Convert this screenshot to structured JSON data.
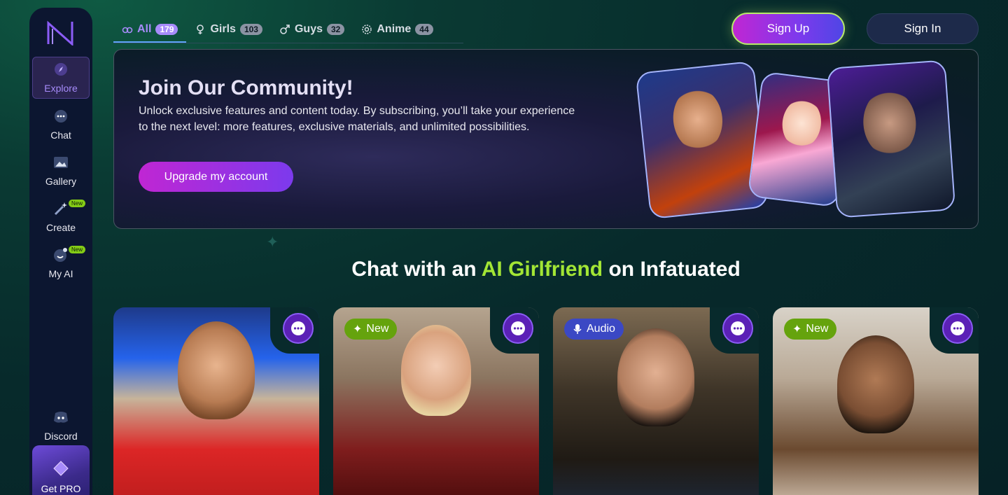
{
  "sidebar": {
    "items": [
      {
        "label": "Explore",
        "icon": "compass-icon",
        "new": false
      },
      {
        "label": "Chat",
        "icon": "chat-bubble-icon",
        "new": false
      },
      {
        "label": "Gallery",
        "icon": "image-icon",
        "new": false
      },
      {
        "label": "Create",
        "icon": "magic-wand-icon",
        "new": true
      },
      {
        "label": "My AI",
        "icon": "ai-face-icon",
        "new": true
      }
    ],
    "new_label": "New",
    "discord_label": "Discord",
    "getpro_label": "Get PRO"
  },
  "tabs": [
    {
      "label": "All",
      "count": "179",
      "icon": "all-genders-icon"
    },
    {
      "label": "Girls",
      "count": "103",
      "icon": "female-icon"
    },
    {
      "label": "Guys",
      "count": "32",
      "icon": "male-icon"
    },
    {
      "label": "Anime",
      "count": "44",
      "icon": "gear-icon"
    }
  ],
  "auth": {
    "signup": "Sign Up",
    "signin": "Sign In"
  },
  "banner": {
    "title": "Join Our Community!",
    "text": "Unlock exclusive features and content today. By subscribing, you’ll take your experience to the next level: more features, exclusive materials, and unlimited possibilities.",
    "button": "Upgrade my account"
  },
  "section": {
    "prefix": "Chat with an ",
    "highlight": "AI Girlfriend",
    "suffix": " on Infatuated"
  },
  "cards": [
    {
      "badge": ""
    },
    {
      "badge": "New"
    },
    {
      "badge": "Audio"
    },
    {
      "badge": "New"
    }
  ],
  "colors": {
    "accent": "#a78bfa",
    "highlight": "#a3e635",
    "new_badge": "#65a30d",
    "audio_badge": "#3b48c4"
  }
}
